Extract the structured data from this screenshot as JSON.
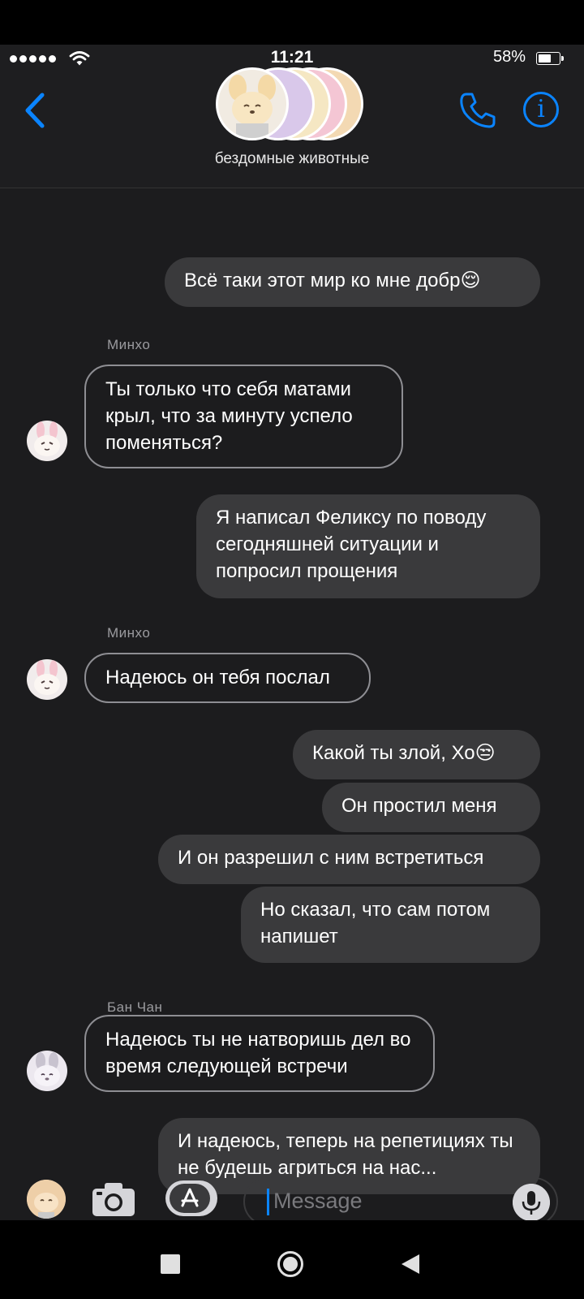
{
  "status_bar": {
    "time": "11:21",
    "battery": "58%",
    "battery_level": 0.58
  },
  "header": {
    "group_name": "бездомные животные"
  },
  "messages": {
    "m1": {
      "text": "Всё таки этот мир ко мне добр😌"
    },
    "m2": {
      "sender": "Минхо",
      "text": "Ты только что себя матами крыл, что за минуту успело поменяться?"
    },
    "m3": {
      "text": "Я написал Феликсу по поводу сегодняшней ситуации и попросил прощения"
    },
    "m4": {
      "sender": "Минхо",
      "text": "Надеюсь он тебя послал"
    },
    "m5": {
      "text": "Какой ты злой, Хо😒"
    },
    "m6": {
      "text": "Он простил меня"
    },
    "m7": {
      "text": "И он разрешил с ним встретиться"
    },
    "m8": {
      "text": "Но сказал, что сам потом напишет"
    },
    "m9": {
      "sender": "Бан Чан",
      "text": "Надеюсь ты не натворишь дел во время следующей встречи"
    },
    "m10": {
      "text": "И надеюсь, теперь на репетициях ты не будешь агриться на нас..."
    }
  },
  "input": {
    "placeholder": "Message"
  },
  "colors": {
    "accent": "#0a84ff",
    "outgoing_bubble": "#3a3a3c",
    "background": "#1c1c1e"
  },
  "icons": [
    "back-chevron-icon",
    "phone-icon",
    "info-icon",
    "camera-icon",
    "app-store-icon",
    "microphone-icon"
  ]
}
